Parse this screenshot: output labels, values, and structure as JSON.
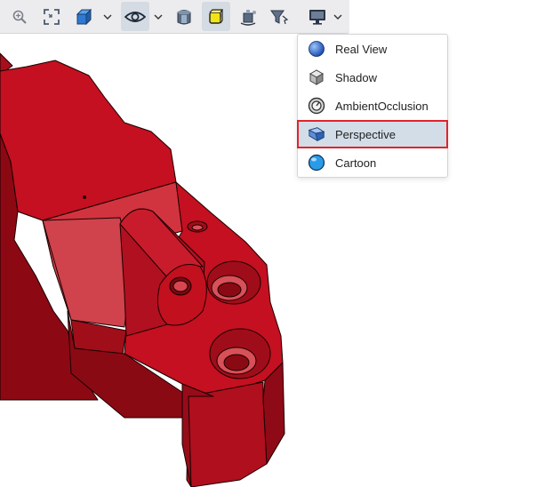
{
  "toolbar": {
    "buttons": [
      {
        "icon": "zoom-icon"
      },
      {
        "icon": "fit-view-icon"
      },
      {
        "icon": "view-cube-icon"
      },
      {
        "icon": "visibility-eye-icon"
      },
      {
        "icon": "section-cut-icon"
      },
      {
        "icon": "yellow-box-icon"
      },
      {
        "icon": "explode-view-icon"
      },
      {
        "icon": "filter-icon"
      },
      {
        "icon": "display-monitor-icon"
      }
    ]
  },
  "render_menu": {
    "items": [
      {
        "label": "Real View",
        "icon": "sphere-icon"
      },
      {
        "label": "Shadow",
        "icon": "shaded-cube-icon"
      },
      {
        "label": "AmbientOcclusion",
        "icon": "ambient-occlusion-icon"
      },
      {
        "label": "Perspective",
        "icon": "perspective-icon"
      },
      {
        "label": "Cartoon",
        "icon": "cartoon-sphere-icon"
      }
    ],
    "selected": "Perspective"
  },
  "colors": {
    "part_red": "#c41020",
    "part_dark": "#8e0a16",
    "part_light": "#d64550",
    "menu_highlight": "#d3dde8",
    "highlight_border": "#e0242c",
    "toolbar_bg": "#ececee"
  }
}
